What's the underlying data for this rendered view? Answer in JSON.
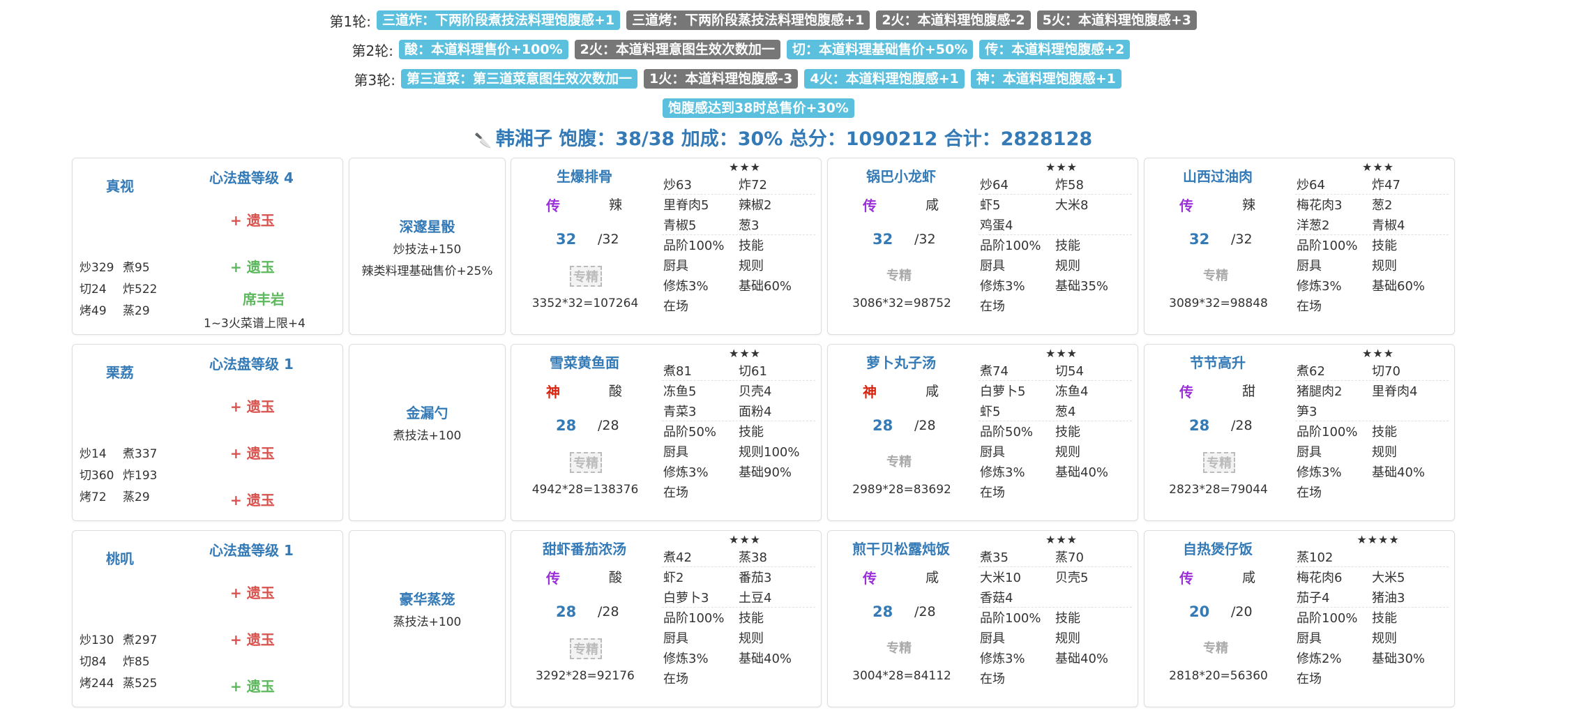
{
  "rounds": [
    {
      "label": "第1轮:",
      "tags": [
        {
          "text": "三道炸：下两阶段煮技法料理饱腹感+1",
          "color": "blue"
        },
        {
          "text": "三道烤：下两阶段蒸技法料理饱腹感+1",
          "color": "gray"
        },
        {
          "text": "2火：本道料理饱腹感-2",
          "color": "gray"
        },
        {
          "text": "5火：本道料理饱腹感+3",
          "color": "gray"
        }
      ]
    },
    {
      "label": "第2轮:",
      "tags": [
        {
          "text": "酸：本道料理售价+100%",
          "color": "blue"
        },
        {
          "text": "2火：本道料理意图生效次数加一",
          "color": "gray"
        },
        {
          "text": "切：本道料理基础售价+50%",
          "color": "blue"
        },
        {
          "text": "传：本道料理饱腹感+2",
          "color": "blue"
        }
      ]
    },
    {
      "label": "第3轮:",
      "tags": [
        {
          "text": "第三道菜：第三道菜意图生效次数加一",
          "color": "blue"
        },
        {
          "text": "1火：本道料理饱腹感-3",
          "color": "gray"
        },
        {
          "text": "4火：本道料理饱腹感+1",
          "color": "blue"
        },
        {
          "text": "神：本道料理饱腹感+1",
          "color": "blue"
        }
      ]
    },
    {
      "label": "",
      "tags": [
        {
          "text": "饱腹感达到38时总售价+30%",
          "color": "blue"
        }
      ]
    }
  ],
  "summary": {
    "icon": "chef-knife-icon",
    "text": "韩湘子 饱腹：38/38 加成：30% 总分：1090212 合计：2828128"
  },
  "rows": [
    {
      "chef": {
        "name": "真视",
        "heart_title": "心法盘等级 4",
        "jades": [
          {
            "text": "+ 遗玉",
            "color": "red"
          },
          {
            "text": "+ 遗玉",
            "color": "green"
          }
        ],
        "stats": [
          [
            "炒329",
            "煮95"
          ],
          [
            "切24",
            "炸522"
          ],
          [
            "烤49",
            "蒸29"
          ]
        ],
        "equip_name": "席丰岩",
        "equip_desc": "1~3火菜谱上限+4"
      },
      "equip": {
        "name": "深邃星骰",
        "lines": [
          "炒技法+150",
          "辣类料理基础售价+25%"
        ]
      },
      "recipes": [
        {
          "name": "生爆排骨",
          "stars": "★★★",
          "rarity": "传",
          "rarity_type": "chuan",
          "taste": "辣",
          "qty": "32",
          "qty_max": "/32",
          "specialty": "专精",
          "boxed": true,
          "price": "3352*32=107264",
          "grid": [
            [
              "炒63",
              "炸72"
            ],
            [
              "里脊肉5",
              "辣椒2"
            ],
            [
              "青椒5",
              "葱3"
            ],
            [
              "品阶100%",
              "技能"
            ],
            [
              "厨具",
              "规则"
            ],
            [
              "修炼3%",
              "基础60%"
            ],
            [
              "在场",
              ""
            ]
          ]
        },
        {
          "name": "锅巴小龙虾",
          "stars": "★★★",
          "rarity": "传",
          "rarity_type": "chuan",
          "taste": "咸",
          "qty": "32",
          "qty_max": "/32",
          "specialty": "专精",
          "boxed": false,
          "price": "3086*32=98752",
          "grid": [
            [
              "炒64",
              "炸58"
            ],
            [
              "虾5",
              "大米8"
            ],
            [
              "鸡蛋4",
              ""
            ],
            [
              "品阶100%",
              "技能"
            ],
            [
              "厨具",
              "规则"
            ],
            [
              "修炼3%",
              "基础35%"
            ],
            [
              "在场",
              ""
            ]
          ]
        },
        {
          "name": "山西过油肉",
          "stars": "★★★",
          "rarity": "传",
          "rarity_type": "chuan",
          "taste": "辣",
          "qty": "32",
          "qty_max": "/32",
          "specialty": "专精",
          "boxed": false,
          "price": "3089*32=98848",
          "grid": [
            [
              "炒64",
              "炸47"
            ],
            [
              "梅花肉3",
              "葱2"
            ],
            [
              "洋葱2",
              "青椒4"
            ],
            [
              "品阶100%",
              "技能"
            ],
            [
              "厨具",
              "规则"
            ],
            [
              "修炼3%",
              "基础60%"
            ],
            [
              "在场",
              ""
            ]
          ]
        }
      ]
    },
    {
      "chef": {
        "name": "栗荔",
        "heart_title": "心法盘等级 1",
        "jades": [
          {
            "text": "+ 遗玉",
            "color": "red"
          },
          {
            "text": "+ 遗玉",
            "color": "red"
          },
          {
            "text": "+ 遗玉",
            "color": "red"
          }
        ],
        "stats": [
          [
            "炒14",
            "煮337"
          ],
          [
            "切360",
            "炸193"
          ],
          [
            "烤72",
            "蒸29"
          ]
        ],
        "equip_name": "",
        "equip_desc": ""
      },
      "equip": {
        "name": "金漏勺",
        "lines": [
          "煮技法+100"
        ]
      },
      "recipes": [
        {
          "name": "雪菜黄鱼面",
          "stars": "★★★",
          "rarity": "神",
          "rarity_type": "shen",
          "taste": "酸",
          "qty": "28",
          "qty_max": "/28",
          "specialty": "专精",
          "boxed": true,
          "price": "4942*28=138376",
          "grid": [
            [
              "煮81",
              "切61"
            ],
            [
              "冻鱼5",
              "贝壳4"
            ],
            [
              "青菜3",
              "面粉4"
            ],
            [
              "品阶50%",
              "技能"
            ],
            [
              "厨具",
              "规则100%"
            ],
            [
              "修炼3%",
              "基础90%"
            ],
            [
              "在场",
              ""
            ]
          ]
        },
        {
          "name": "萝卜丸子汤",
          "stars": "★★★",
          "rarity": "神",
          "rarity_type": "shen",
          "taste": "咸",
          "qty": "28",
          "qty_max": "/28",
          "specialty": "专精",
          "boxed": false,
          "price": "2989*28=83692",
          "grid": [
            [
              "煮74",
              "切54"
            ],
            [
              "白萝卜5",
              "冻鱼4"
            ],
            [
              "虾5",
              "葱4"
            ],
            [
              "品阶50%",
              "技能"
            ],
            [
              "厨具",
              "规则"
            ],
            [
              "修炼3%",
              "基础40%"
            ],
            [
              "在场",
              ""
            ]
          ]
        },
        {
          "name": "节节高升",
          "stars": "★★★",
          "rarity": "传",
          "rarity_type": "chuan",
          "taste": "甜",
          "qty": "28",
          "qty_max": "/28",
          "specialty": "专精",
          "boxed": true,
          "price": "2823*28=79044",
          "grid": [
            [
              "煮62",
              "切70"
            ],
            [
              "猪腿肉2",
              "里脊肉4"
            ],
            [
              "笋3",
              ""
            ],
            [
              "品阶100%",
              "技能"
            ],
            [
              "厨具",
              "规则"
            ],
            [
              "修炼3%",
              "基础40%"
            ],
            [
              "在场",
              ""
            ]
          ]
        }
      ]
    },
    {
      "chef": {
        "name": "桃叽",
        "heart_title": "心法盘等级 1",
        "jades": [
          {
            "text": "+ 遗玉",
            "color": "red"
          },
          {
            "text": "+ 遗玉",
            "color": "red"
          },
          {
            "text": "+ 遗玉",
            "color": "green"
          }
        ],
        "stats": [
          [
            "炒130",
            "煮297"
          ],
          [
            "切84",
            "炸85"
          ],
          [
            "烤244",
            "蒸525"
          ]
        ],
        "equip_name": "",
        "equip_desc": ""
      },
      "equip": {
        "name": "豪华蒸笼",
        "lines": [
          "蒸技法+100"
        ]
      },
      "recipes": [
        {
          "name": "甜虾番茄浓汤",
          "stars": "★★★",
          "rarity": "传",
          "rarity_type": "chuan",
          "taste": "酸",
          "qty": "28",
          "qty_max": "/28",
          "specialty": "专精",
          "boxed": true,
          "price": "3292*28=92176",
          "grid": [
            [
              "煮42",
              "蒸38"
            ],
            [
              "虾2",
              "番茄3"
            ],
            [
              "白萝卜3",
              "土豆4"
            ],
            [
              "品阶100%",
              "技能"
            ],
            [
              "厨具",
              "规则"
            ],
            [
              "修炼3%",
              "基础40%"
            ],
            [
              "在场",
              ""
            ]
          ]
        },
        {
          "name": "煎干贝松露炖饭",
          "stars": "★★★",
          "rarity": "传",
          "rarity_type": "chuan",
          "taste": "咸",
          "qty": "28",
          "qty_max": "/28",
          "specialty": "专精",
          "boxed": false,
          "price": "3004*28=84112",
          "grid": [
            [
              "煮35",
              "蒸70"
            ],
            [
              "大米10",
              "贝壳5"
            ],
            [
              "香菇4",
              ""
            ],
            [
              "品阶100%",
              "技能"
            ],
            [
              "厨具",
              "规则"
            ],
            [
              "修炼3%",
              "基础40%"
            ],
            [
              "在场",
              ""
            ]
          ]
        },
        {
          "name": "自热煲仔饭",
          "stars": "★★★★",
          "rarity": "传",
          "rarity_type": "chuan",
          "taste": "咸",
          "qty": "20",
          "qty_max": "/20",
          "specialty": "专精",
          "boxed": false,
          "price": "2818*20=56360",
          "grid": [
            [
              "蒸102",
              ""
            ],
            [
              "梅花肉6",
              "大米5"
            ],
            [
              "茄子4",
              "猪油3"
            ],
            [
              "品阶100%",
              "技能"
            ],
            [
              "厨具",
              "规则"
            ],
            [
              "修炼2%",
              "基础30%"
            ],
            [
              "在场",
              ""
            ]
          ]
        }
      ]
    }
  ]
}
